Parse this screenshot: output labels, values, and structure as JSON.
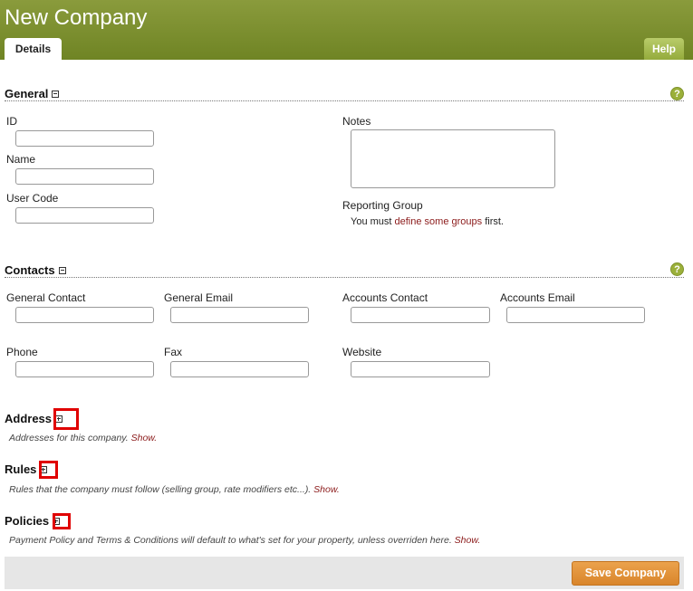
{
  "page": {
    "title": "New Company"
  },
  "tabs": {
    "details": "Details",
    "help": "Help"
  },
  "general": {
    "heading": "General",
    "help": "?",
    "id_label": "ID",
    "name_label": "Name",
    "user_code_label": "User Code",
    "notes_label": "Notes",
    "reporting_group_label": "Reporting Group",
    "reporting_note_pre": "You must ",
    "reporting_note_link": "define some groups",
    "reporting_note_post": " first.",
    "id_value": "",
    "name_value": "",
    "user_code_value": "",
    "notes_value": ""
  },
  "contacts": {
    "heading": "Contacts",
    "help": "?",
    "general_contact_label": "General Contact",
    "general_email_label": "General Email",
    "accounts_contact_label": "Accounts Contact",
    "accounts_email_label": "Accounts Email",
    "phone_label": "Phone",
    "fax_label": "Fax",
    "website_label": "Website"
  },
  "address": {
    "heading": "Address",
    "desc": "Addresses for this company. ",
    "show": "Show."
  },
  "rules": {
    "heading": "Rules",
    "desc": "Rules that the company must follow (selling group, rate modifiers etc...). ",
    "show": "Show."
  },
  "policies": {
    "heading": "Policies",
    "desc": "Payment Policy and Terms & Conditions will default to what's set for your property, unless overriden here. ",
    "show": "Show."
  },
  "footer": {
    "save_label": "Save Company"
  }
}
